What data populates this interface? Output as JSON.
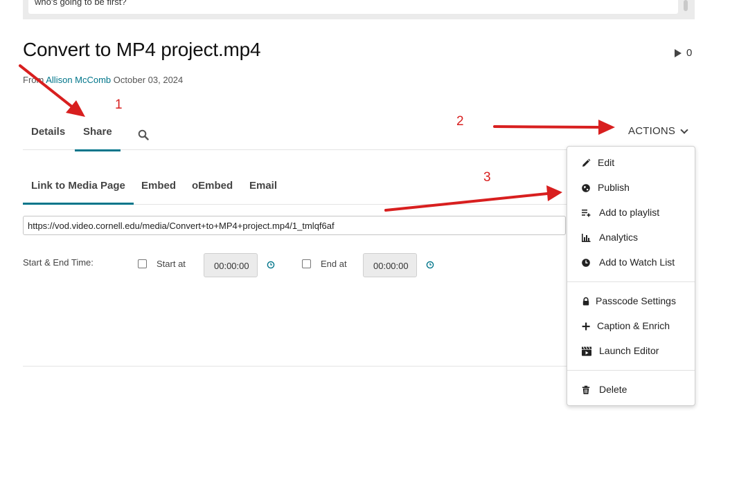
{
  "comment_preview": "who's going to be first?",
  "media": {
    "title": "Convert to MP4 project.mp4",
    "play_count": "0",
    "byline_prefix": "From",
    "author": "Allison McComb",
    "date": "October 03, 2024"
  },
  "main_tabs": [
    {
      "label": "Details"
    },
    {
      "label": "Share"
    }
  ],
  "actions_label": "ACTIONS",
  "sub_tabs": [
    {
      "label": "Link to Media Page"
    },
    {
      "label": "Embed"
    },
    {
      "label": "oEmbed"
    },
    {
      "label": "Email"
    }
  ],
  "share": {
    "link_url": "https://vod.video.cornell.edu/media/Convert+to+MP4+project.mp4/1_tmlqf6af",
    "start_end_label": "Start & End Time:",
    "start_label": "Start at",
    "start_value": "00:00:00",
    "end_label": "End at",
    "end_value": "00:00:00"
  },
  "actions_menu": {
    "group1": [
      {
        "label": "Edit",
        "icon": "pencil-icon"
      },
      {
        "label": "Publish",
        "icon": "globe-icon"
      },
      {
        "label": "Add to playlist",
        "icon": "playlist-add-icon"
      },
      {
        "label": "Analytics",
        "icon": "bar-chart-icon"
      },
      {
        "label": "Add to Watch List",
        "icon": "clock-icon"
      }
    ],
    "group2": [
      {
        "label": "Passcode Settings",
        "icon": "lock-icon"
      },
      {
        "label": "Caption & Enrich",
        "icon": "plus-icon"
      },
      {
        "label": "Launch Editor",
        "icon": "clapperboard-icon"
      }
    ],
    "group3": [
      {
        "label": "Delete",
        "icon": "trash-icon"
      }
    ]
  },
  "annotations": {
    "n1": "1",
    "n2": "2",
    "n3": "3"
  },
  "colors": {
    "accent": "#00758a",
    "annotation": "#d81f1f"
  }
}
